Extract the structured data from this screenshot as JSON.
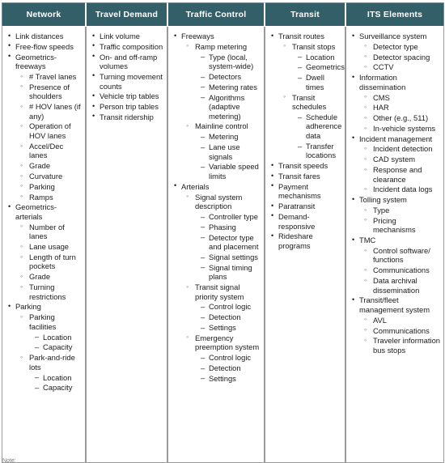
{
  "table": {
    "headers": [
      {
        "label": "Network"
      },
      {
        "label": "Travel Demand"
      },
      {
        "label": "Traffic Control"
      },
      {
        "label": "Transit"
      },
      {
        "label": "ITS Elements"
      }
    ],
    "header_bg": "#336068",
    "header_text_color": "#ffffff",
    "border_color": "#9a9a9a",
    "columns": [
      {
        "name": "network",
        "items": [
          {
            "level": 1,
            "text": "Link distances"
          },
          {
            "level": 1,
            "text": "Free-flow speeds"
          },
          {
            "level": 1,
            "text": "Geometrics-freeways"
          },
          {
            "level": 2,
            "text": "# Travel lanes"
          },
          {
            "level": 2,
            "text": "Presence of shoulders"
          },
          {
            "level": 2,
            "text": "# HOV lanes (if any)"
          },
          {
            "level": 2,
            "text": "Operation of HOV lanes"
          },
          {
            "level": 2,
            "text": "Accel/Dec lanes"
          },
          {
            "level": 2,
            "text": "Grade"
          },
          {
            "level": 2,
            "text": "Curvature"
          },
          {
            "level": 2,
            "text": "Parking"
          },
          {
            "level": 2,
            "text": "Ramps"
          },
          {
            "level": 1,
            "text": "Geometrics-arterials"
          },
          {
            "level": 2,
            "text": "Number of lanes"
          },
          {
            "level": 2,
            "text": "Lane usage"
          },
          {
            "level": 2,
            "text": "Length of turn pockets"
          },
          {
            "level": 2,
            "text": "Grade"
          },
          {
            "level": 2,
            "text": "Turning restrictions"
          },
          {
            "level": 1,
            "text": "Parking"
          },
          {
            "level": 2,
            "text": "Parking facilities"
          },
          {
            "level": 3,
            "text": "Location"
          },
          {
            "level": 3,
            "text": "Capacity"
          },
          {
            "level": 2,
            "text": "Park-and-ride lots"
          },
          {
            "level": 3,
            "text": "Location"
          },
          {
            "level": 3,
            "text": "Capacity"
          }
        ]
      },
      {
        "name": "travel-demand",
        "items": [
          {
            "level": 1,
            "text": "Link volume"
          },
          {
            "level": 1,
            "text": "Traffic composition"
          },
          {
            "level": 1,
            "text": "On- and off-ramp volumes"
          },
          {
            "level": 1,
            "text": "Turning movement counts"
          },
          {
            "level": 1,
            "text": "Vehicle trip tables"
          },
          {
            "level": 1,
            "text": "Person trip tables"
          },
          {
            "level": 1,
            "text": "Transit ridership"
          }
        ]
      },
      {
        "name": "traffic-control",
        "items": [
          {
            "level": 1,
            "text": "Freeways"
          },
          {
            "level": 2,
            "text": "Ramp metering"
          },
          {
            "level": 3,
            "text": "Type (local, system-wide)"
          },
          {
            "level": 3,
            "text": "Detectors"
          },
          {
            "level": 3,
            "text": "Metering rates"
          },
          {
            "level": 3,
            "text": "Algorithms (adaptive metering)"
          },
          {
            "level": 2,
            "text": "Mainline control"
          },
          {
            "level": 3,
            "text": "Metering"
          },
          {
            "level": 3,
            "text": "Lane use signals"
          },
          {
            "level": 3,
            "text": "Variable speed limits"
          },
          {
            "level": 1,
            "text": "Arterials"
          },
          {
            "level": 2,
            "text": "Signal system description"
          },
          {
            "level": 3,
            "text": "Controller type"
          },
          {
            "level": 3,
            "text": "Phasing"
          },
          {
            "level": 3,
            "text": "Detector type and placement"
          },
          {
            "level": 3,
            "text": "Signal settings"
          },
          {
            "level": 3,
            "text": "Signal timing plans"
          },
          {
            "level": 2,
            "text": "Transit signal priority system"
          },
          {
            "level": 3,
            "text": "Control logic"
          },
          {
            "level": 3,
            "text": "Detection"
          },
          {
            "level": 3,
            "text": "Settings"
          },
          {
            "level": 2,
            "text": "Emergency preemption system"
          },
          {
            "level": 3,
            "text": "Control logic"
          },
          {
            "level": 3,
            "text": "Detection"
          },
          {
            "level": 3,
            "text": "Settings"
          }
        ]
      },
      {
        "name": "transit",
        "items": [
          {
            "level": 1,
            "text": "Transit routes"
          },
          {
            "level": 2,
            "text": "Transit stops"
          },
          {
            "level": 3,
            "text": "Location"
          },
          {
            "level": 3,
            "text": "Geometrics"
          },
          {
            "level": 3,
            "text": "Dwell times"
          },
          {
            "level": 2,
            "text": "Transit schedules"
          },
          {
            "level": 3,
            "text": "Schedule adherence data"
          },
          {
            "level": 3,
            "text": "Transfer locations"
          },
          {
            "level": 1,
            "text": "Transit speeds"
          },
          {
            "level": 1,
            "text": "Transit fares"
          },
          {
            "level": 1,
            "text": "Payment mechanisms"
          },
          {
            "level": 1,
            "text": "Paratransit"
          },
          {
            "level": 1,
            "text": "Demand-responsive"
          },
          {
            "level": 1,
            "text": "Rideshare programs"
          }
        ]
      },
      {
        "name": "its-elements",
        "items": [
          {
            "level": 1,
            "text": "Surveillance system"
          },
          {
            "level": 2,
            "text": "Detector type"
          },
          {
            "level": 2,
            "text": "Detector spacing"
          },
          {
            "level": 2,
            "text": "CCTV"
          },
          {
            "level": 1,
            "text": "Information dissemination"
          },
          {
            "level": 2,
            "text": "CMS"
          },
          {
            "level": 2,
            "text": "HAR"
          },
          {
            "level": 2,
            "text": "Other (e.g., 511)"
          },
          {
            "level": 2,
            "text": "In-vehicle systems"
          },
          {
            "level": 1,
            "text": "Incident management"
          },
          {
            "level": 2,
            "text": "Incident detection"
          },
          {
            "level": 2,
            "text": "CAD system"
          },
          {
            "level": 2,
            "text": "Response and clearance"
          },
          {
            "level": 2,
            "text": "Incident data logs"
          },
          {
            "level": 1,
            "text": "Tolling system"
          },
          {
            "level": 2,
            "text": "Type"
          },
          {
            "level": 2,
            "text": "Pricing mechanisms"
          },
          {
            "level": 1,
            "text": "TMC"
          },
          {
            "level": 2,
            "text": "Control software/ functions"
          },
          {
            "level": 2,
            "text": "Communications"
          },
          {
            "level": 2,
            "text": "Data archival dissemination"
          },
          {
            "level": 1,
            "text": "Transit/fleet management system"
          },
          {
            "level": 2,
            "text": "AVL"
          },
          {
            "level": 2,
            "text": "Communications"
          },
          {
            "level": 2,
            "text": "Traveler information bus stops"
          }
        ]
      }
    ]
  },
  "caption": {
    "text": "Note:"
  }
}
